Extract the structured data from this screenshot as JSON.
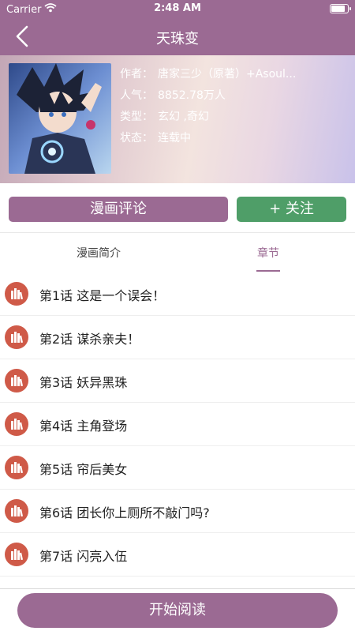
{
  "status_bar": {
    "carrier": "Carrier",
    "time": "2:48 AM",
    "battery_level": 0.9
  },
  "nav": {
    "title": "天珠变"
  },
  "comic": {
    "author_label": "作者：",
    "author": "唐家三少（原著）+Asoul...",
    "popularity_label": "人气：",
    "popularity": "8852.78万人",
    "genre_label": "类型：",
    "genre": "玄幻 ,奇幻",
    "status_label": "状态：",
    "status": "连载中"
  },
  "actions": {
    "review_label": "漫画评论",
    "follow_label": "+ 关注"
  },
  "tabs": [
    {
      "label": "漫画简介",
      "selected": false
    },
    {
      "label": "章节",
      "selected": true
    }
  ],
  "chapters": [
    "第1话 这是一个误会！",
    "第2话 谋杀亲夫！",
    "第3话 妖异黑珠",
    "第4话 主角登场",
    "第5话 帘后美女",
    "第6话 团长你上厕所不敲门吗?",
    "第7话 闪亮入伍"
  ],
  "bottom": {
    "read_label": "开始阅读"
  },
  "colors": {
    "theme": "#9b6a93",
    "follow": "#4f9e68",
    "chapter_icon": "#cf5a48"
  }
}
